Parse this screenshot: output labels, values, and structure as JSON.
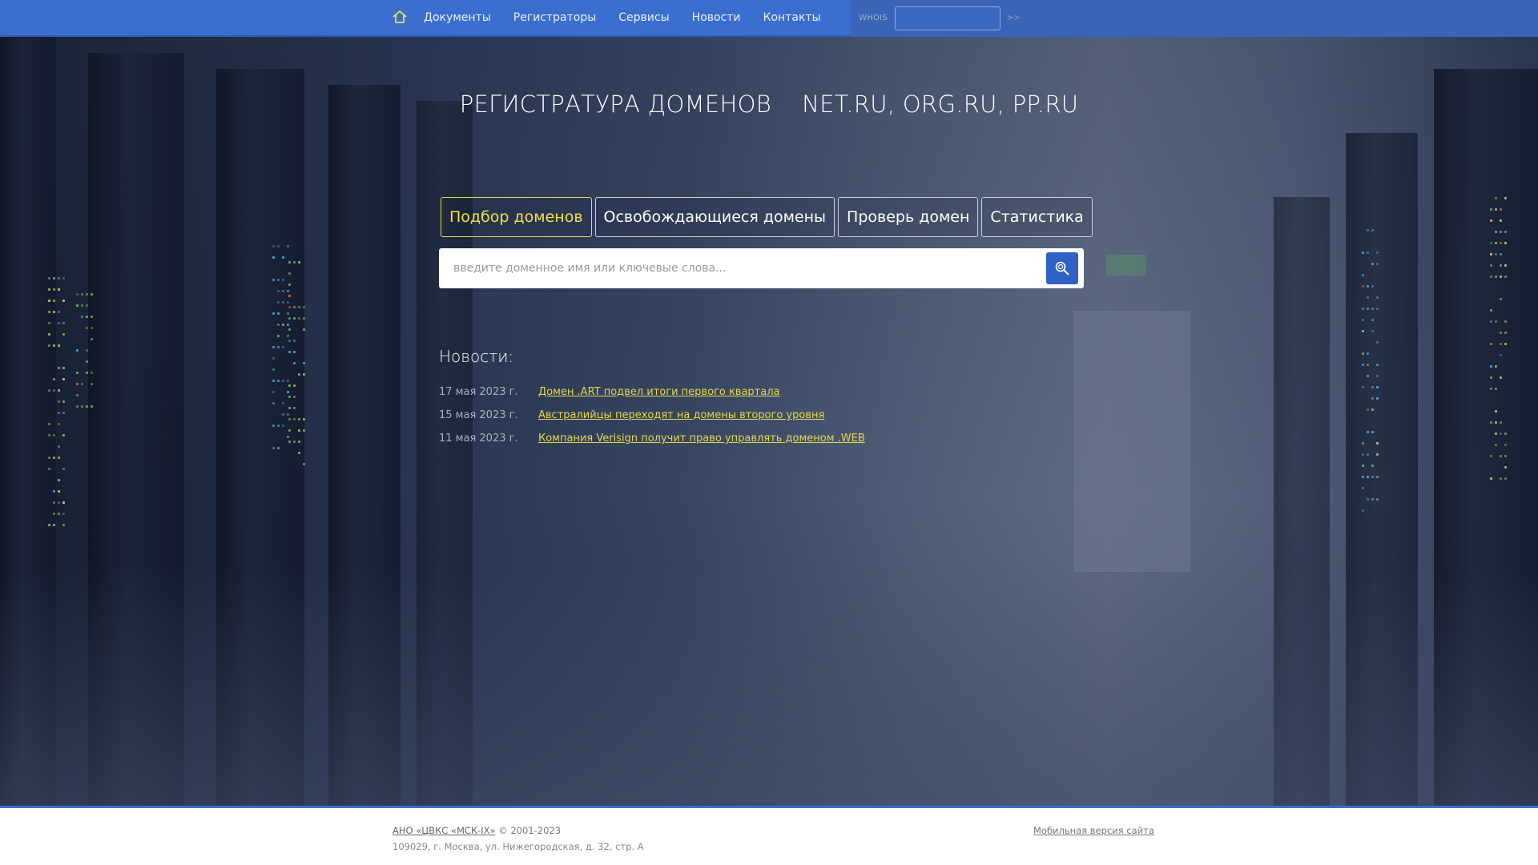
{
  "header": {
    "home_icon": "home-icon",
    "nav": [
      {
        "label": "Документы"
      },
      {
        "label": "Регистраторы"
      },
      {
        "label": "Сервисы"
      },
      {
        "label": "Новости"
      },
      {
        "label": "Контакты"
      }
    ],
    "whois": {
      "label": "WHOIS",
      "value": "",
      "go_label": ">>"
    }
  },
  "hero": {
    "title": "РЕГИСТРАТУРА ДОМЕНОВ    NET.RU, ORG.RU, PP.RU",
    "tabs": [
      {
        "label": "Подбор доменов",
        "active": true
      },
      {
        "label": "Освобождающиеся домены",
        "active": false
      },
      {
        "label": "Проверь домен",
        "active": false
      },
      {
        "label": "Статистика",
        "active": false
      }
    ],
    "search": {
      "placeholder": "введите доменное имя или ключевые слова...",
      "value": "",
      "button_icon": "search-icon"
    }
  },
  "news": {
    "heading": "Новости:",
    "items": [
      {
        "date": "17 мая 2023 г.",
        "title": "Домен .ART подвел итоги первого квартала"
      },
      {
        "date": "15 мая 2023 г.",
        "title": "Австралийцы переходят на домены второго уровня"
      },
      {
        "date": "11 мая 2023 г.",
        "title": "Компания Verisign получит право управлять доменом .WEB"
      }
    ]
  },
  "footer": {
    "org_link": "АНО «ЦВКС «МСК-IX»",
    "copyright": " © 2001-2023",
    "address": "109029, г. Москва, ул. Нижегородская, д. 32, стр. А",
    "mobile_link": "Мобильная версия сайта"
  },
  "colors": {
    "nav_bar": "#3a6fd0",
    "accent_yellow": "#e6d84a",
    "search_button": "#2f62c4"
  }
}
